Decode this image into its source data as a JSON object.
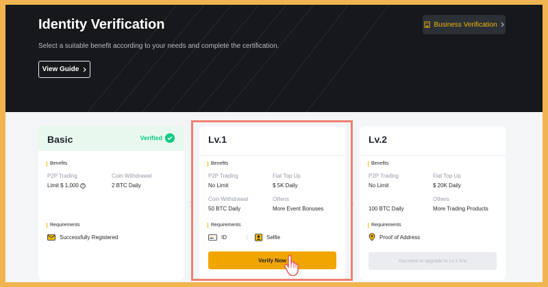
{
  "hero": {
    "title": "Identity Verification",
    "subtitle": "Select a suitable benefit according to your needs and complete the certification.",
    "guide_label": "View Guide",
    "business_label": "Business Verification"
  },
  "cards": {
    "basic": {
      "title": "Basic",
      "status": "Verified",
      "benefits_label": "Benefits",
      "benefits": [
        {
          "label": "P2P Trading",
          "value": "Limit $ 1,000"
        },
        {
          "label": "Coin Withdrawal",
          "value": "2 BTC Daily"
        }
      ],
      "requirements_label": "Requirements",
      "requirements": [
        "Successfully Registered"
      ]
    },
    "lv1": {
      "title": "Lv.1",
      "benefits_label": "Benefits",
      "benefits": [
        {
          "label": "P2P Trading",
          "value": "No Limit"
        },
        {
          "label": "Fiat Top Up",
          "value": "$ 5K Daily"
        },
        {
          "label": "Coin Withdrawal",
          "value": "50 BTC Daily"
        },
        {
          "label": "Others",
          "value": "More Event Bonuses"
        }
      ],
      "requirements_label": "Requirements",
      "requirements": [
        "ID",
        "Selfie"
      ],
      "action_label": "Verify Now"
    },
    "lv2": {
      "title": "Lv.2",
      "benefits_label": "Benefits",
      "benefits": [
        {
          "label": "P2P Trading",
          "value": "No Limit"
        },
        {
          "label": "Fiat Top Up",
          "value": "$ 20K Daily"
        },
        {
          "label": "Others",
          "value": "More Trading Products"
        },
        {
          "label": "Coin Withdrawal",
          "value": "100 BTC Daily"
        }
      ],
      "requirements_label": "Requirements",
      "requirements": [
        "Proof of Address"
      ],
      "action_label": "You need to upgrade to Lv.1 first"
    }
  },
  "colors": {
    "accent": "#f0b90b",
    "button": "#f0a500",
    "verified": "#0ecb81",
    "highlight": "#f08070"
  },
  "icons": [
    "chevron-right-icon",
    "building-icon",
    "check-icon",
    "info-icon",
    "envelope-icon",
    "id-card-icon",
    "selfie-icon",
    "location-pin-icon",
    "hand-pointer-icon"
  ]
}
